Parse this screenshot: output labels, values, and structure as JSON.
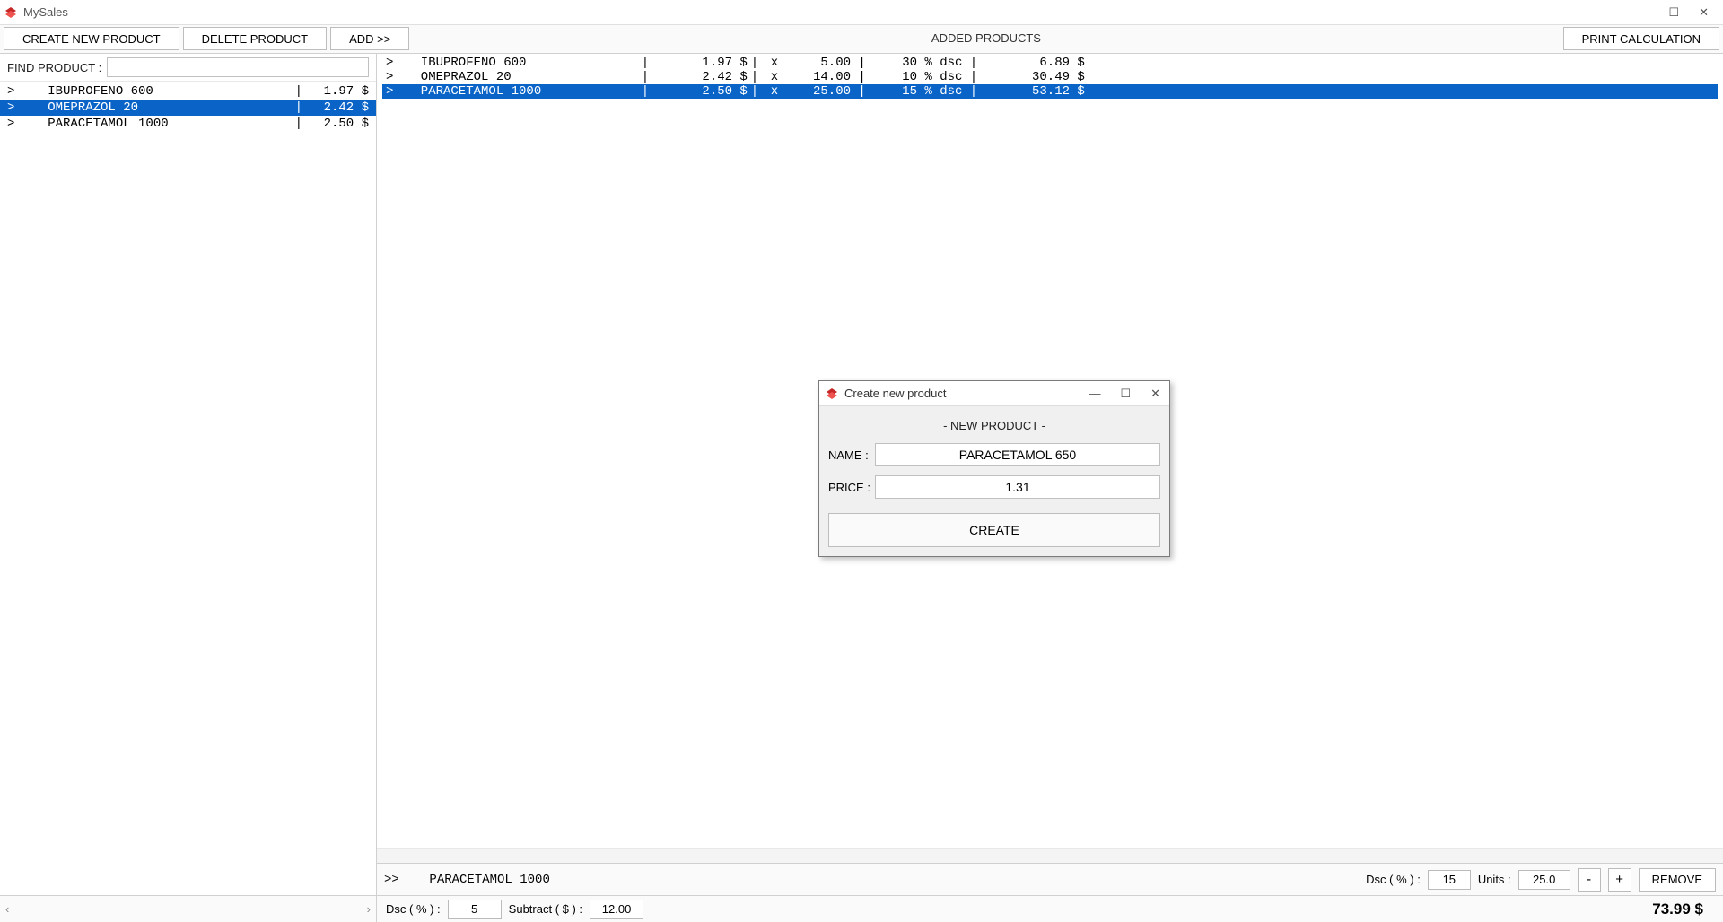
{
  "window": {
    "title": "MySales"
  },
  "toolbar": {
    "create_label": "CREATE NEW PRODUCT",
    "delete_label": "DELETE PRODUCT",
    "add_label": "ADD   >>",
    "center_label": "ADDED PRODUCTS",
    "print_label": "PRINT CALCULATION"
  },
  "find": {
    "label": "FIND PRODUCT :",
    "value": ""
  },
  "products": [
    {
      "name": "IBUPROFENO 600",
      "price": "1.97 $",
      "selected": false
    },
    {
      "name": "OMEPRAZOL 20",
      "price": "2.42 $",
      "selected": true
    },
    {
      "name": "PARACETAMOL 1000",
      "price": "2.50 $",
      "selected": false
    }
  ],
  "added": [
    {
      "name": "IBUPROFENO 600",
      "price": "1.97",
      "qty": "5.00",
      "dsc": "30",
      "total": "6.89",
      "selected": false
    },
    {
      "name": "OMEPRAZOL 20",
      "price": "2.42",
      "qty": "14.00",
      "dsc": "10",
      "total": "30.49",
      "selected": false
    },
    {
      "name": "PARACETAMOL 1000",
      "price": "2.50",
      "qty": "25.00",
      "dsc": "15",
      "total": "53.12",
      "selected": true
    }
  ],
  "added_footer": {
    "selected_prefix": ">>",
    "selected_name": "PARACETAMOL 1000",
    "dsc_label": "Dsc ( % ) :",
    "dsc_value": "15",
    "units_label": "Units :",
    "units_value": "25.0",
    "minus": "-",
    "plus": "+",
    "remove_label": "REMOVE"
  },
  "bottom": {
    "dsc_label": "Dsc ( % ) :",
    "dsc_value": "5",
    "sub_label": "Subtract ( $ ) :",
    "sub_value": "12.00",
    "grand_total": "73.99 $"
  },
  "dialog": {
    "title": "Create new product",
    "header": "- NEW PRODUCT -",
    "name_label": "NAME :",
    "name_value": "PARACETAMOL 650",
    "price_label": "PRICE :",
    "price_value": "1.31",
    "create_label": "CREATE"
  }
}
